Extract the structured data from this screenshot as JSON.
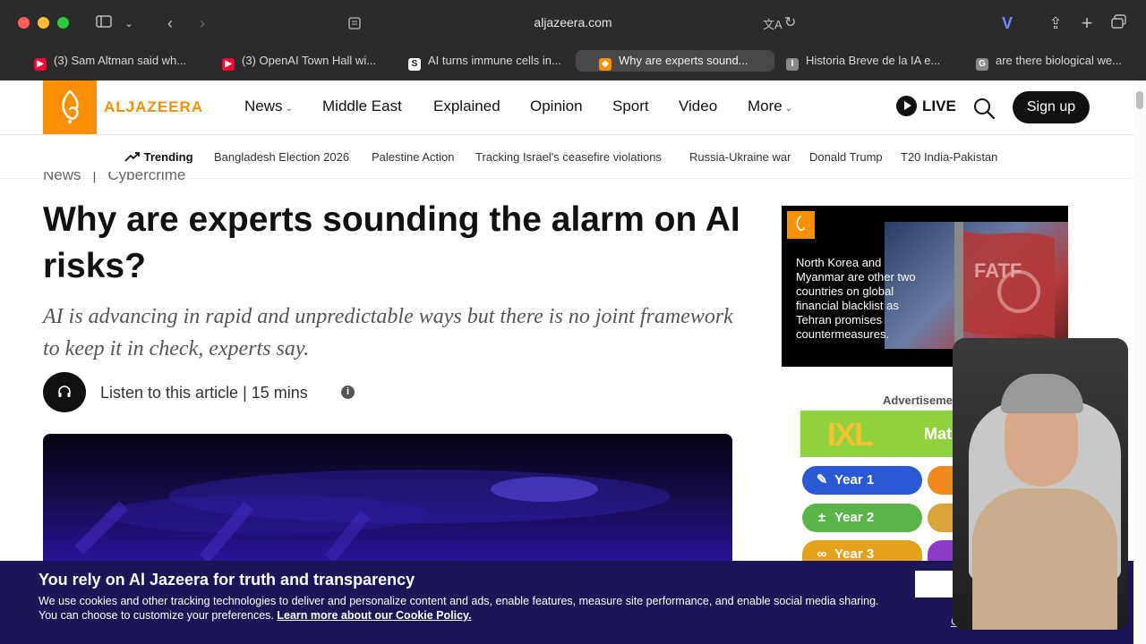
{
  "browser": {
    "url": "aljazeera.com",
    "tabs": [
      {
        "label": "(3) Sam Altman said wh...",
        "favicon": "youtube-icon",
        "color": "#ff0033"
      },
      {
        "label": "(3) OpenAI Town Hall wi...",
        "favicon": "youtube-icon",
        "color": "#ff0033"
      },
      {
        "label": "AI turns immune cells in...",
        "favicon": "sd-icon",
        "color": "#ffffff"
      },
      {
        "label": "Why are experts sound...",
        "favicon": "aljazeera-icon",
        "color": "#fa9000"
      },
      {
        "label": "Historia Breve de la IA e...",
        "favicon": "doc-icon",
        "color": "#888888"
      },
      {
        "label": "are there biological we...",
        "favicon": "google-icon",
        "color": "#888888"
      }
    ]
  },
  "site": {
    "logo": "ALJAZEERA",
    "nav": [
      "News",
      "Middle East",
      "Explained",
      "Opinion",
      "Sport",
      "Video",
      "More"
    ],
    "live": "LIVE",
    "signup": "Sign up",
    "trending_label": "Trending",
    "trending": [
      "Bangladesh Election 2026",
      "Palestine Action",
      "Tracking Israel's ceasefire violations",
      "Russia-Ukraine war",
      "Donald Trump",
      "T20 India-Pakistan"
    ]
  },
  "article": {
    "crumb_section": "News",
    "crumb_sep": "|",
    "crumb_topic": "Cybercrime",
    "title": "Why are experts sounding the alarm on AI risks?",
    "subtitle": "AI is advancing in rapid and unpredictable ways but there is no joint framework to keep it in check, experts say.",
    "listen": "Listen to this article | 15 mins"
  },
  "sidebar": {
    "promo_text": "North Korea and Myanmar are other two countries on global financial blacklist as Tehran promises countermeasures.",
    "promo_img_text": "FATF",
    "ad_label": "Advertisement",
    "ad_brand": "IXL",
    "ad_brand_sub": "Mat",
    "years": [
      "Year 1",
      "Year 2",
      "Year 3"
    ]
  },
  "cookie": {
    "title": "You rely on Al Jazeera for truth and transparency",
    "body": "We use cookies and other tracking technologies to deliver and personalize content and ads, enable features, measure site performance, and enable social media sharing. You can choose to customize your preferences.",
    "link": "Learn more about our Cookie Policy.",
    "customize": "Cu"
  },
  "colors": {
    "brand": "#fa9000",
    "cookie_bg": "#1c1557"
  }
}
